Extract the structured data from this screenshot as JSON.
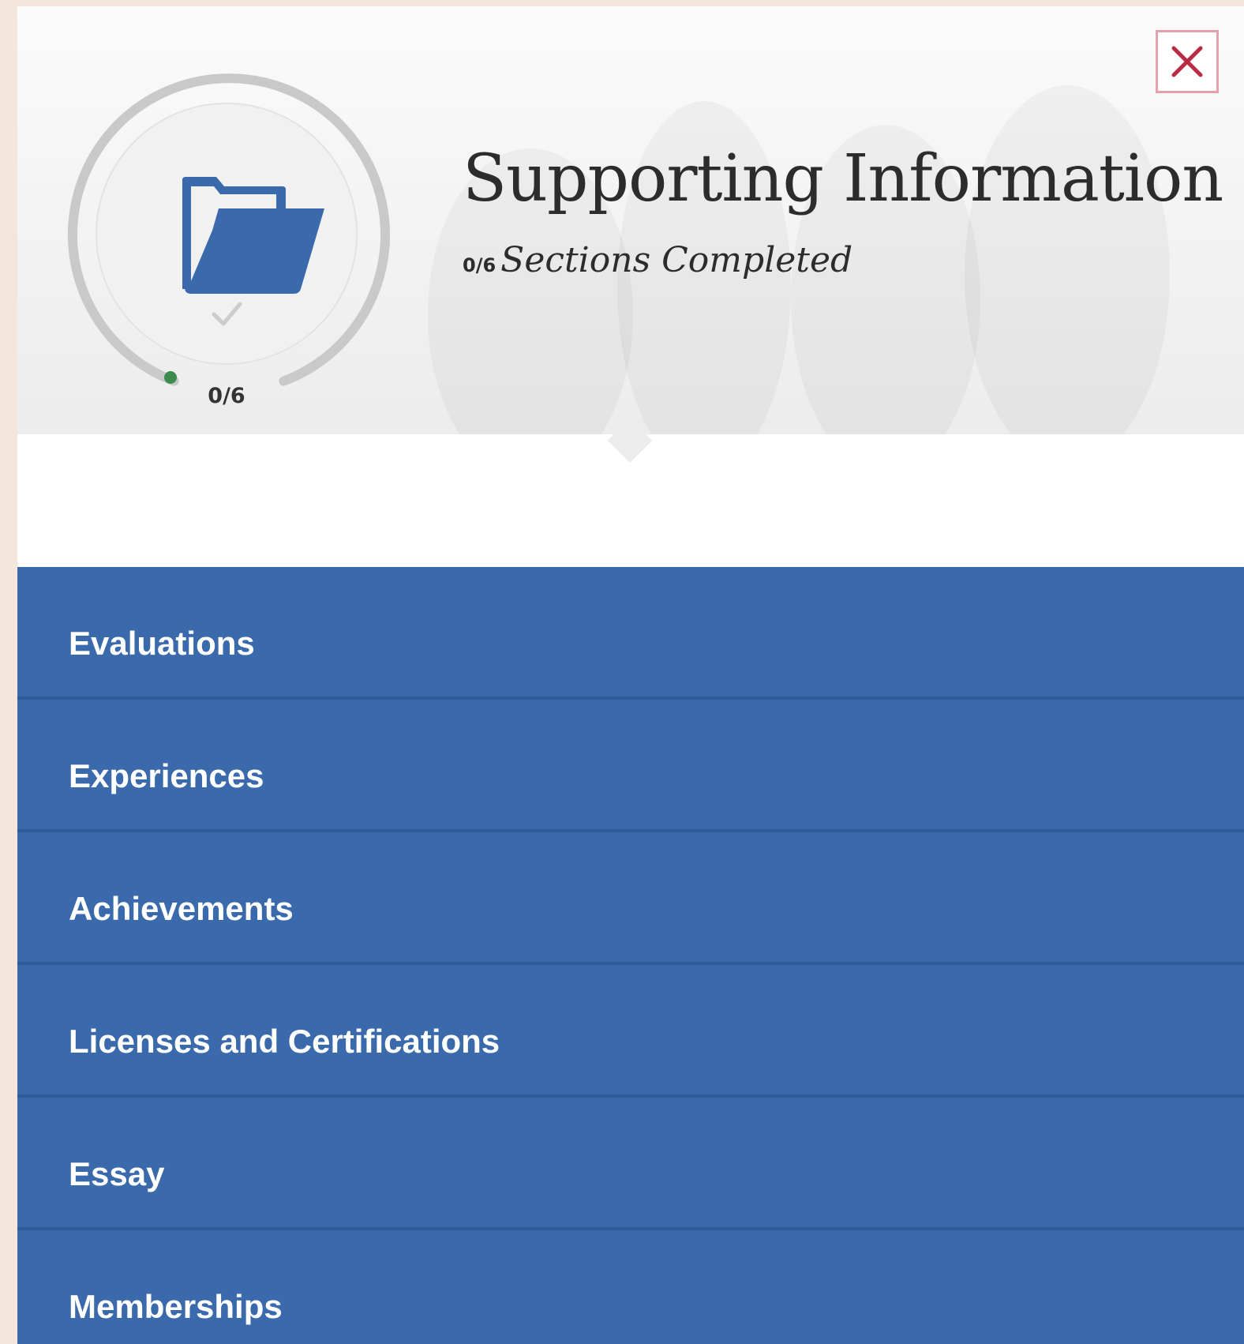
{
  "header": {
    "title": "Supporting Information",
    "completed_count": "0/6",
    "completed_label": "Sections Completed",
    "progress_label": "0/6",
    "progress_fraction": 0,
    "icon": "folder-icon",
    "check_icon": "check-icon",
    "close_icon": "close-icon"
  },
  "sections": [
    {
      "label": "Evaluations"
    },
    {
      "label": "Experiences"
    },
    {
      "label": "Achievements"
    },
    {
      "label": "Licenses and Certifications"
    },
    {
      "label": "Essay"
    },
    {
      "label": "Memberships"
    }
  ],
  "colors": {
    "accent_blue": "#3a6aab",
    "close_red": "#b82c43",
    "progress_green": "#3d8a4e",
    "page_background": "#f3e6da"
  }
}
